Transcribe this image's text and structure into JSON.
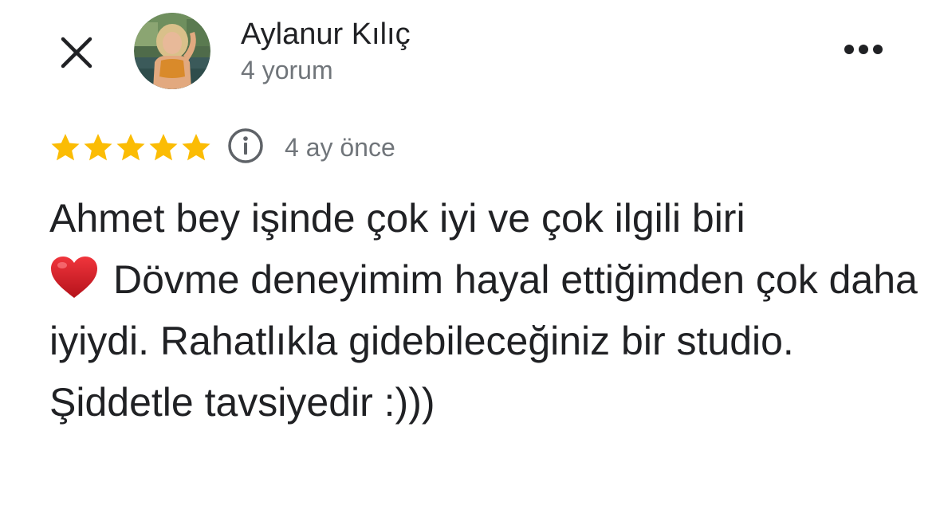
{
  "header": {
    "close_icon": "close-icon",
    "more_icon": "more-horizontal-icon",
    "avatar_icon": "avatar-photo"
  },
  "reviewer": {
    "name": "Aylanur Kılıç",
    "review_count": "4 yorum"
  },
  "review": {
    "rating": 5,
    "rating_max": 5,
    "star_color": "#fbbc04",
    "info_icon": "info-icon",
    "time_ago": "4 ay önce",
    "text_before_emoji": "Ahmet bey işinde çok iyi ve çok ilgili biri",
    "emoji": "heart-emoji",
    "text_after_emoji": "Dövme deneyimim hayal ettiğimden çok daha iyiydi. Rahatlıkla gidebileceğiniz bir studio. Şiddetle tavsiyedir :)))"
  }
}
